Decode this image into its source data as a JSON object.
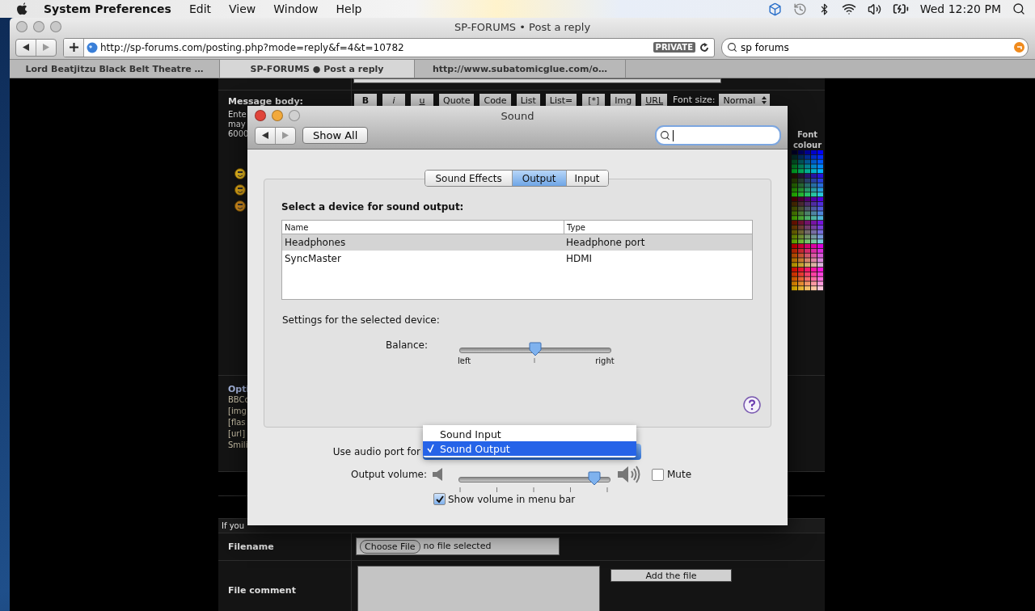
{
  "menu_bar": {
    "app": "System Preferences",
    "menus": [
      "Edit",
      "View",
      "Window",
      "Help"
    ],
    "clock": "Wed 12:20 PM"
  },
  "browser": {
    "title": "SP-FORUMS • Post a reply",
    "url": "http://sp-forums.com/posting.php?mode=reply&f=4&t=10782",
    "private_badge": "PRIVATE",
    "search": {
      "value": "sp forums"
    },
    "tabs": [
      {
        "label": "Lord Beatjitzu Black Belt Theatre …",
        "selected": false
      },
      {
        "label": "SP-FORUMS ● Post a reply",
        "selected": true
      },
      {
        "label": "http://www.subatomicglue.com/o…",
        "selected": false
      }
    ]
  },
  "forum": {
    "message_label": "Message body:",
    "message_hint_lines": [
      "Ente",
      "may",
      "6000"
    ],
    "toolbar": [
      {
        "label": "B",
        "kind": "bold"
      },
      {
        "label": "i",
        "kind": "italic"
      },
      {
        "label": "u",
        "kind": "underline"
      },
      {
        "label": "Quote",
        "kind": "plain"
      },
      {
        "label": "Code",
        "kind": "plain"
      },
      {
        "label": "List",
        "kind": "plain"
      },
      {
        "label": "List=",
        "kind": "plain"
      },
      {
        "label": "[*]",
        "kind": "plain"
      },
      {
        "label": "Img",
        "kind": "plain"
      },
      {
        "label": "URL",
        "kind": "underline"
      }
    ],
    "font_size_label": "Font size:",
    "font_size_value": "Normal",
    "font_colour_label": "Font colour",
    "options_title": "Opti",
    "options_lines": [
      "BBCo",
      "[img",
      "[flas",
      "[url]",
      "Smili"
    ],
    "notice": "If you",
    "filename_label": "Filename",
    "choose_file": "Choose File",
    "no_file": "no file selected",
    "comment_label": "File comment",
    "add_file": "Add the file"
  },
  "sound": {
    "title": "Sound",
    "show_all": "Show All",
    "tabs": [
      {
        "label": "Sound Effects",
        "selected": false
      },
      {
        "label": "Output",
        "selected": true
      },
      {
        "label": "Input",
        "selected": false
      }
    ],
    "device_heading": "Select a device for sound output:",
    "columns": [
      "Name",
      "Type"
    ],
    "devices": [
      {
        "name": "Headphones",
        "type": "Headphone port",
        "selected": true
      },
      {
        "name": "SyncMaster",
        "type": "HDMI",
        "selected": false
      }
    ],
    "settings_label": "Settings for the selected device:",
    "balance": {
      "label": "Balance:",
      "level": 0.5,
      "left": "left",
      "right": "right"
    },
    "audio_port_label": "Use audio port for",
    "audio_port_menu": [
      {
        "label": "Sound Input",
        "selected": false
      },
      {
        "label": "Sound Output",
        "selected": true
      }
    ],
    "output_volume": {
      "label": "Output volume:",
      "level": 0.9
    },
    "mute": {
      "label": "Mute",
      "checked": false
    },
    "show_volume": {
      "label": "Show volume in menu bar",
      "checked": true
    }
  }
}
